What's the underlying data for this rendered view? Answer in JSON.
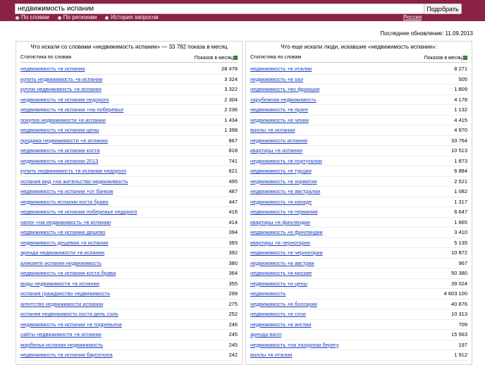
{
  "search": {
    "query": "недвижимость испании",
    "button": "Подобрать"
  },
  "modes": [
    {
      "label": "По словам",
      "selected": true
    },
    {
      "label": "По регионам",
      "selected": false
    },
    {
      "label": "История запросов",
      "selected": false
    }
  ],
  "region": "Россия",
  "updated": "Последнее обновление: 11.09.2013",
  "left": {
    "title": "Что искали со словами «недвижимость испании» — 33 782 показа в месяц",
    "col1": "Статистика по словам",
    "col2": "Показов в месяц",
    "rows": [
      {
        "text": "недвижимость +в испании",
        "count": "28 478"
      },
      {
        "text": "купить недвижимость +в испании",
        "count": "3 324"
      },
      {
        "text": "куплю недвижимость +в испании",
        "count": "3 322"
      },
      {
        "text": "недвижимость +в испании недорого",
        "count": "2 304"
      },
      {
        "text": "недвижимость +в испании +на побережье",
        "count": "2 236"
      },
      {
        "text": "покупка недвижимости +в испании",
        "count": "1 434"
      },
      {
        "text": "недвижимость +в испании цены",
        "count": "1 398"
      },
      {
        "text": "продажа недвижимости +в испании",
        "count": "867"
      },
      {
        "text": "недвижимость +в испании коста",
        "count": "818"
      },
      {
        "text": "недвижимость +в испании 2013",
        "count": "741"
      },
      {
        "text": "купить недвижимость +в испании недорого",
        "count": "621"
      },
      {
        "text": "испания вид +на жительство недвижимость",
        "count": "495"
      },
      {
        "text": "недвижимость +в испании +от банков",
        "count": "487"
      },
      {
        "text": "недвижимость испании коста браво",
        "count": "447"
      },
      {
        "text": "недвижимость +в испании побережье недорого",
        "count": "416"
      },
      {
        "text": "налог +на недвижимость +в испании",
        "count": "414"
      },
      {
        "text": "недвижимость +в испании дешево",
        "count": "394"
      },
      {
        "text": "недвижимость дешевая +в испании",
        "count": "393"
      },
      {
        "text": "аренда недвижимости +в испании",
        "count": "392"
      },
      {
        "text": "аликанте испания недвижимость",
        "count": "380"
      },
      {
        "text": "недвижимость +в испании коста брава",
        "count": "364"
      },
      {
        "text": "виды недвижимости +в испании",
        "count": "355"
      },
      {
        "text": "испания гражданство недвижимость",
        "count": "299"
      },
      {
        "text": "агентство недвижимости испании",
        "count": "275"
      },
      {
        "text": "испания недвижимость коста дель соль",
        "count": "252"
      },
      {
        "text": "недвижимость +в испании +в торревьеха",
        "count": "246"
      },
      {
        "text": "сайты недвижимости +в испании",
        "count": "245"
      },
      {
        "text": "марбелья испания недвижимость",
        "count": "245"
      },
      {
        "text": "недвижимость +в испании барселона",
        "count": "242"
      }
    ]
  },
  "right": {
    "title": "Что еще искали люди, искавшие «недвижимость испании»:",
    "col1": "Статистика по словам",
    "col2": "Показов в месяц",
    "rows": [
      {
        "text": "недвижимость +в италии",
        "count": "8 271"
      },
      {
        "text": "недвижимость +в оаэ",
        "count": "505"
      },
      {
        "text": "недвижимость +во франции",
        "count": "1 809"
      },
      {
        "text": "зарубежная недвижимость",
        "count": "4 178"
      },
      {
        "text": "недвижимость +в праге",
        "count": "1 132"
      },
      {
        "text": "недвижимость +в чехии",
        "count": "4 415"
      },
      {
        "text": "виллы +в испании",
        "count": "4 970"
      },
      {
        "text": "недвижимость испания",
        "count": "33 764"
      },
      {
        "text": "квартиры +в испании",
        "count": "10 513"
      },
      {
        "text": "недвижимость +в португалии",
        "count": "1 873"
      },
      {
        "text": "недвижимость +в турции",
        "count": "6 884"
      },
      {
        "text": "недвижимость +в хорватии",
        "count": "2 521"
      },
      {
        "text": "недвижимость +в австралии",
        "count": "1 082"
      },
      {
        "text": "недвижимость +в канаде",
        "count": "1 317"
      },
      {
        "text": "недвижимость +в германии",
        "count": "6 647"
      },
      {
        "text": "квартиры +в финляндии",
        "count": "1 665"
      },
      {
        "text": "недвижимость +в финляндии",
        "count": "3 410"
      },
      {
        "text": "квартиры +в черногории",
        "count": "5 135"
      },
      {
        "text": "недвижимость +в черногории",
        "count": "10 872"
      },
      {
        "text": "недвижимость +в австрии",
        "count": "967"
      },
      {
        "text": "недвижимость +в москве",
        "count": "50 380"
      },
      {
        "text": "недвижимость +и цены",
        "count": "39 024"
      },
      {
        "text": "недвижимость",
        "count": "4 603 100"
      },
      {
        "text": "недвижимость +в болгарии",
        "count": "40 876"
      },
      {
        "text": "недвижимость +в сочи",
        "count": "10 313"
      },
      {
        "text": "недвижимость +в англии",
        "count": "709"
      },
      {
        "text": "аренда вилл",
        "count": "15 563"
      },
      {
        "text": "недвижимость +на лазурном берегу",
        "count": "197"
      },
      {
        "text": "виллы +в италии",
        "count": "1 912"
      }
    ]
  }
}
